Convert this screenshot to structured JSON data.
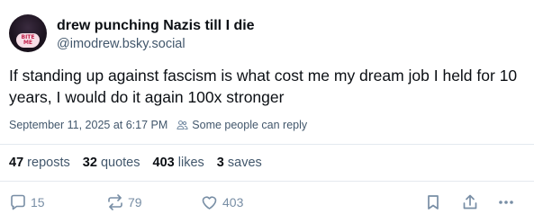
{
  "author": {
    "display_name": "drew punching Nazis till I die",
    "handle": "@imodrew.bsky.social",
    "avatar_text": "BITE ME"
  },
  "post": {
    "text": "If standing up against fascism is what cost me my dream job I held for 10 years, I would do it again 100x stronger",
    "timestamp": "September 11, 2025 at 6:17 PM",
    "reply_setting": "Some people can reply"
  },
  "stats": {
    "reposts_count": "47",
    "reposts_label": "reposts",
    "quotes_count": "32",
    "quotes_label": "quotes",
    "likes_count": "403",
    "likes_label": "likes",
    "saves_count": "3",
    "saves_label": "saves"
  },
  "actions": {
    "reply_count": "15",
    "repost_count": "79",
    "like_count": "403",
    "icons": [
      "reply-icon",
      "repost-icon",
      "like-icon",
      "bookmark-icon",
      "share-icon",
      "more-icon"
    ]
  },
  "colors": {
    "text": "#0b0f14",
    "muted": "#42576c",
    "icon": "#788ea5",
    "divider": "#e4e9ef"
  }
}
